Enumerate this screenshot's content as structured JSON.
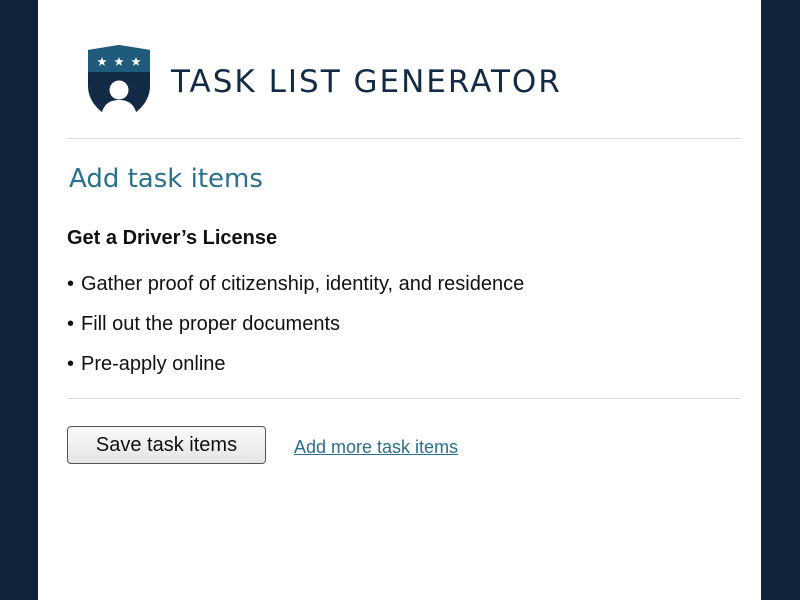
{
  "header": {
    "title": "TASK LIST GENERATOR",
    "logo_icon": "shield-person-icon",
    "brand_color": "#1f5b7a",
    "dark_color": "#132b44"
  },
  "section": {
    "title": "Add task items"
  },
  "task": {
    "heading": "Get a Driver’s License",
    "bullet": "•",
    "items": [
      "Gather proof of citizenship, identity, and residence",
      "Fill out the proper documents",
      "Pre-apply online"
    ]
  },
  "actions": {
    "save_label": "Save task items",
    "add_more_label": "Add more task items"
  }
}
